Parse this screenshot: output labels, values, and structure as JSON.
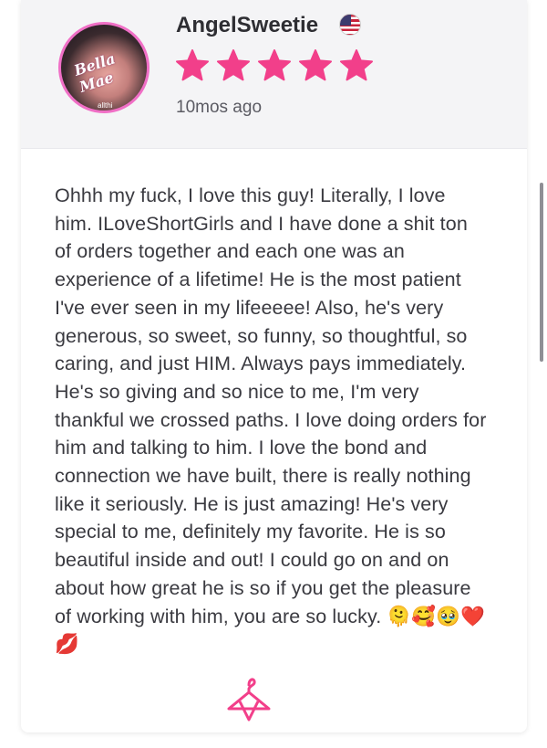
{
  "review": {
    "username": "AngelSweetie",
    "time_ago": "10mos ago",
    "rating": 5,
    "text": "Ohhh my fuck, I love this guy! Literally, I love him. ILoveShortGirls and I have done a shit ton of orders together and each one was an experience of a lifetime! He is the most patient I've ever seen in my lifeeeee! Also, he's very generous, so sweet, so funny, so thoughtful, so caring, and just HIM. Always pays immediately. He's so giving and so nice to me, I'm very thankful we crossed paths. I love doing orders for him and talking to him. I love the bond and connection we have built, there is really nothing like it seriously. He is just amazing! He's very special to me, definitely my favorite. He is so beautiful inside and out! I could go on and on about how great he is so if you get the pleasure of working with him, you are so lucky. 🫠🥰🥹❤️💋",
    "avatar_text": "Bella Mae",
    "avatar_subtext": "allthi"
  },
  "icons": {
    "flag": "us-flag-icon",
    "star": "star-icon",
    "footer": "hanger-icon"
  },
  "colors": {
    "star": "#f23f8a",
    "avatar_border": "#f06fc6",
    "header_bg": "#f4f4f6"
  }
}
